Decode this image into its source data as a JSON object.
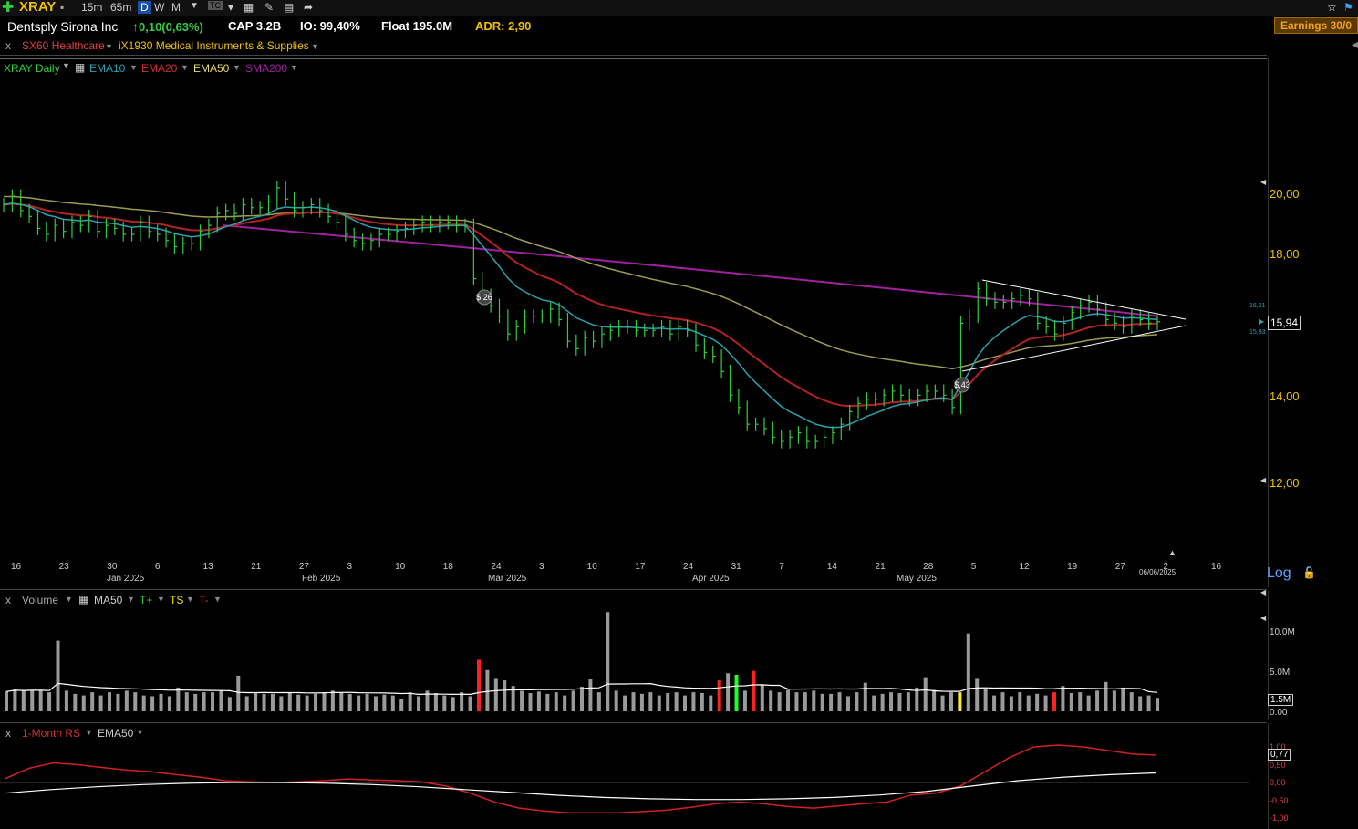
{
  "toolbar": {
    "symbol": "XRAY",
    "tf_15m": "15m",
    "tf_65m": "65m",
    "tf_d": "D",
    "tf_w": "W",
    "tf_m": "M",
    "icons": [
      "add-icon",
      "print-icon",
      "menu-caret-icon",
      "tc-icon",
      "doc-icon",
      "edit-icon",
      "share-icon",
      "star-icon",
      "flag-icon"
    ]
  },
  "info": {
    "company": "Dentsply Sirona Inc",
    "change": "0,10(0,63%)",
    "cap": "CAP 3.2B",
    "io": "IO: 99,40%",
    "float": "Float 195.0M",
    "adr": "ADR: 2,90",
    "earnings": "Earnings 30/0"
  },
  "sector": {
    "x": "x",
    "sector": "SX60 Healthcare",
    "industry": "iX1930 Medical Instruments & Supplies"
  },
  "price_panel": {
    "x": "x",
    "legend": {
      "daily": "XRAY Daily",
      "ema10": "EMA10",
      "ema20": "EMA20",
      "ema50": "EMA50",
      "sma200": "SMA200"
    },
    "colors": {
      "ema10": "#2aa0b0",
      "ema20": "#b22222",
      "ema50": "#9b9b50",
      "sma200": "#a020a0",
      "bars": "#2ecc40"
    },
    "annotations": {
      "eps1": "$,26",
      "eps2": "$,43"
    },
    "price_box": "15,94",
    "small_hi": "16,21",
    "small_lo": "15,93",
    "log_label": "Log"
  },
  "volume_panel": {
    "x": "x",
    "legend": {
      "volume": "Volume",
      "ma50": "MA50",
      "tplus": "T+",
      "ts": "TS",
      "tminus": "T-"
    },
    "ylabels": [
      "10.0M",
      "5.0M",
      "0.00"
    ],
    "ma_box": "1.5M"
  },
  "rs_panel": {
    "x": "x",
    "legend": {
      "rs": "1-Month RS",
      "ema50": "EMA50"
    },
    "ylabels": [
      "1,00",
      "0,50",
      "0,00",
      "-0,50",
      "-1,00"
    ],
    "value_box": "0,77"
  },
  "chart_data": {
    "type": "line",
    "price_yticks": [
      "20,00",
      "18,00",
      "14,00",
      "12,00"
    ],
    "x_ticks": [
      "16",
      "23",
      "30",
      "6",
      "13",
      "21",
      "27",
      "3",
      "10",
      "18",
      "24",
      "3",
      "10",
      "17",
      "24",
      "31",
      "7",
      "14",
      "21",
      "28",
      "5",
      "12",
      "19",
      "27",
      "2",
      "16"
    ],
    "month_labels": [
      "Jan 2025",
      "Feb 2025",
      "Mar 2025",
      "Apr 2025",
      "May 2025"
    ],
    "last_date": "06/06/2025",
    "close": [
      19.6,
      19.9,
      19.4,
      19.2,
      18.8,
      18.6,
      18.9,
      18.7,
      19.0,
      18.9,
      19.2,
      18.7,
      18.9,
      18.8,
      18.6,
      18.6,
      19.0,
      18.7,
      18.6,
      18.4,
      18.2,
      18.3,
      18.3,
      18.7,
      18.9,
      19.3,
      19.4,
      19.3,
      19.6,
      19.5,
      19.5,
      19.7,
      20.2,
      19.8,
      19.4,
      19.5,
      19.6,
      19.4,
      19.2,
      19.0,
      18.6,
      18.4,
      18.3,
      18.4,
      18.6,
      18.6,
      18.7,
      18.8,
      18.9,
      19.0,
      18.9,
      19.0,
      19.0,
      18.9,
      18.9,
      17.2,
      16.7,
      16.4,
      16.1,
      15.6,
      15.8,
      16.1,
      16.1,
      16.1,
      16.3,
      16.0,
      15.4,
      15.2,
      15.5,
      15.4,
      15.6,
      15.7,
      15.8,
      15.8,
      15.7,
      15.7,
      15.7,
      15.8,
      15.6,
      15.8,
      15.7,
      15.3,
      15.1,
      15.0,
      14.6,
      14.0,
      13.7,
      13.3,
      13.3,
      13.2,
      13.0,
      12.9,
      13.0,
      13.1,
      12.9,
      12.9,
      13.0,
      13.1,
      13.3,
      13.6,
      13.8,
      13.9,
      13.9,
      14.0,
      14.1,
      14.0,
      13.9,
      14.0,
      14.1,
      14.1,
      14.0,
      13.7,
      15.9,
      16.1,
      16.9,
      16.6,
      16.5,
      16.5,
      16.6,
      16.7,
      16.6,
      15.9,
      15.8,
      15.6,
      15.9,
      16.2,
      16.4,
      16.5,
      16.3,
      16.0,
      15.9,
      15.8,
      16.1,
      16.0,
      15.9,
      15.94
    ],
    "sma200": [
      18.9,
      18.7,
      18.5,
      18.3,
      18.1,
      17.9,
      17.7,
      17.5,
      17.3,
      17.1,
      16.9,
      16.7,
      16.5,
      16.3,
      16.1
    ],
    "volume_M": [
      2.5,
      2.8,
      2.6,
      2.7,
      2.7,
      2.4,
      8.9,
      2.6,
      2.2,
      2.0,
      2.4,
      2.0,
      2.4,
      2.2,
      2.6,
      2.4,
      2.0,
      1.9,
      2.2,
      1.9,
      3.0,
      2.4,
      2.2,
      2.4,
      2.4,
      2.6,
      1.8,
      4.5,
      1.9,
      2.4,
      2.2,
      2.2,
      1.9,
      2.4,
      2.1,
      2.0,
      2.2,
      2.4,
      2.6,
      2.4,
      2.2,
      2.0,
      2.2,
      1.9,
      2.1,
      2.0,
      1.6,
      2.4,
      1.9,
      2.6,
      2.3,
      2.0,
      1.8,
      2.4,
      1.9,
      6.5,
      5.2,
      4.2,
      3.9,
      3.2,
      2.6,
      2.3,
      2.5,
      2.2,
      2.4,
      2.0,
      2.6,
      3.1,
      4.1,
      2.4,
      12.5,
      2.6,
      2.0,
      2.4,
      2.2,
      2.4,
      2.0,
      2.3,
      2.4,
      2.0,
      2.4,
      2.3,
      2.0,
      3.9,
      4.8,
      4.6,
      2.6,
      5.1,
      3.3,
      2.6,
      2.4,
      2.7,
      2.4,
      2.4,
      2.6,
      2.2,
      2.2,
      2.4,
      1.9,
      2.4,
      3.6,
      2.0,
      2.2,
      2.4,
      2.3,
      2.4,
      3.0,
      4.3,
      2.7,
      2.0,
      2.4,
      2.4,
      9.8,
      4.2,
      2.8,
      2.0,
      2.4,
      1.9,
      2.4,
      2.0,
      2.2,
      2.0,
      2.4,
      3.2,
      2.3,
      2.4,
      2.0,
      2.6,
      3.7,
      2.6,
      3.0,
      2.4,
      1.9,
      2.0,
      1.7
    ],
    "rs": [
      0.1,
      0.4,
      0.55,
      0.5,
      0.42,
      0.35,
      0.3,
      0.22,
      0.15,
      0.05,
      0.02,
      0.0,
      0.02,
      0.05,
      0.1,
      0.07,
      0.05,
      0.02,
      -0.1,
      -0.3,
      -0.55,
      -0.72,
      -0.8,
      -0.85,
      -0.85,
      -0.85,
      -0.82,
      -0.78,
      -0.7,
      -0.6,
      -0.55,
      -0.6,
      -0.68,
      -0.72,
      -0.66,
      -0.6,
      -0.55,
      -0.35,
      -0.3,
      -0.1,
      0.3,
      0.7,
      1.0,
      1.05,
      1.0,
      0.9,
      0.8,
      0.77
    ],
    "rs_ema50": [
      -0.3,
      -0.2,
      -0.12,
      -0.06,
      -0.02,
      0.0,
      0.0,
      -0.02,
      -0.06,
      -0.12,
      -0.2,
      -0.28,
      -0.36,
      -0.42,
      -0.46,
      -0.48,
      -0.48,
      -0.46,
      -0.42,
      -0.35,
      -0.25,
      -0.1,
      0.05,
      0.15,
      0.22,
      0.27
    ]
  }
}
